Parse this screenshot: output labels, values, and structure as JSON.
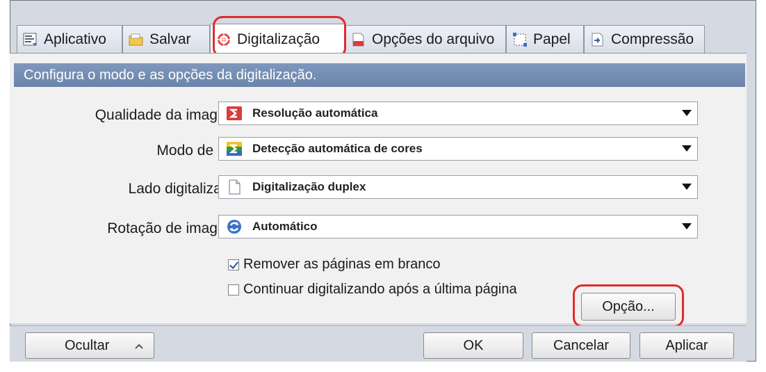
{
  "tabs": [
    {
      "label": "Aplicativo",
      "icon": "application-icon"
    },
    {
      "label": "Salvar",
      "icon": "folder-icon"
    },
    {
      "label": "Digitalização",
      "icon": "scan-icon"
    },
    {
      "label": "Opções do arquivo",
      "icon": "file-options-icon"
    },
    {
      "label": "Papel",
      "icon": "paper-icon"
    },
    {
      "label": "Compressão",
      "icon": "compression-icon"
    }
  ],
  "active_tab": "Digitalização",
  "description": "Configura o modo e as opções da digitalização.",
  "fields": [
    {
      "label": "Qualidade da imagem:",
      "value": "Resolução automática",
      "icon": "resolution-icon"
    },
    {
      "label": "Modo de cor:",
      "value": "Detecção automática de cores",
      "icon": "color-mode-icon"
    },
    {
      "label": "Lado digitalizado:",
      "value": "Digitalização duplex",
      "icon": "document-icon"
    },
    {
      "label": "Rotação de imagem:",
      "value": "Automático",
      "icon": "rotate-icon"
    }
  ],
  "checkboxes": [
    {
      "label": "Remover as páginas em branco",
      "checked": true
    },
    {
      "label": "Continuar digitalizando após a última página",
      "checked": false
    }
  ],
  "buttons": {
    "option": "Opção...",
    "hide": "Ocultar",
    "ok": "OK",
    "cancel": "Cancelar",
    "apply": "Aplicar"
  },
  "colors": {
    "highlight": "#e02b2b",
    "description_bar": "#7289b0"
  }
}
